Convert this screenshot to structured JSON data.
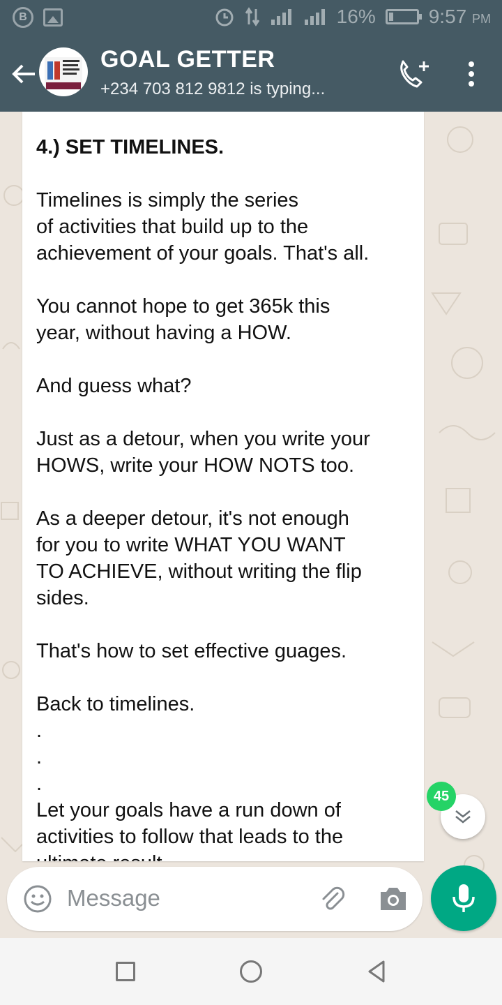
{
  "status_bar": {
    "battery": "16%",
    "battery_level": 0.16,
    "time": "9:57",
    "ampm": "PM"
  },
  "header": {
    "title": "GOAL GETTER",
    "subtitle": "+234 703 812 9812 is typing..."
  },
  "message": {
    "heading": "4.) SET TIMELINES.",
    "body": "Timelines is simply the series\nof activities that build up to the\nachievement of your goals. That's all.\n\nYou cannot hope to get 365k this\nyear, without having a HOW.\n\nAnd guess what?\n\nJust as a detour, when you write your\nHOWS, write your HOW NOTS too.\n\nAs a deeper detour, it's not enough\nfor you to write WHAT YOU WANT\nTO ACHIEVE, without writing the flip\nsides.\n\nThat's how to set effective guages.\n\nBack to timelines.\n.\n.\n.\nLet your goals have a run down of\nactivities to follow that leads to the\nultimate result."
  },
  "unread_badge": "45",
  "composer": {
    "placeholder": "Message"
  },
  "colors": {
    "header": "#455a64",
    "chat_bg": "#ece5dd",
    "mic": "#00a884",
    "badge": "#25d366"
  },
  "icons": [
    "back-arrow-icon",
    "add-call-icon",
    "more-vert-icon",
    "emoji-icon",
    "attach-icon",
    "camera-icon",
    "mic-icon",
    "chevron-down-icon"
  ]
}
